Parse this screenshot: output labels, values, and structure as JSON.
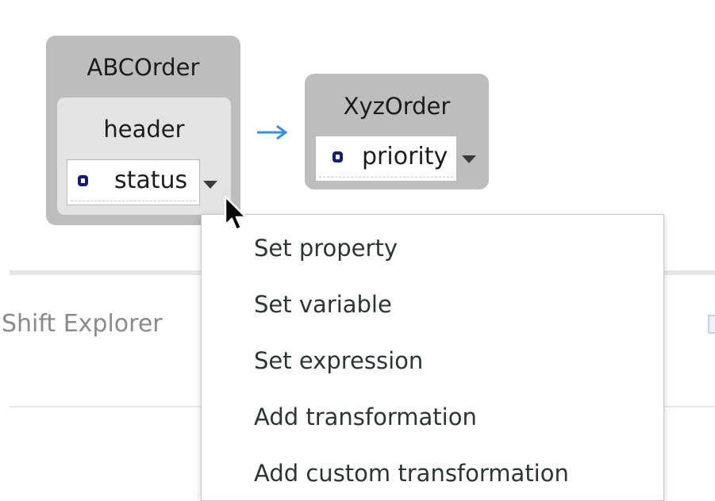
{
  "diagram": {
    "source_node": {
      "title": "ABCOrder",
      "group": {
        "title": "header",
        "field": {
          "label": "status",
          "icon": "property-icon"
        }
      }
    },
    "target_node": {
      "title": "XyzOrder",
      "field": {
        "label": "priority",
        "icon": "property-icon"
      }
    },
    "connector_color": "#3a8fd9"
  },
  "background_panel": {
    "tab_label": "Shift Explorer"
  },
  "context_menu": {
    "items": [
      {
        "label": "Set property"
      },
      {
        "label": "Set variable"
      },
      {
        "label": "Set expression"
      },
      {
        "label": "Add transformation"
      },
      {
        "label": "Add custom transformation"
      }
    ]
  }
}
